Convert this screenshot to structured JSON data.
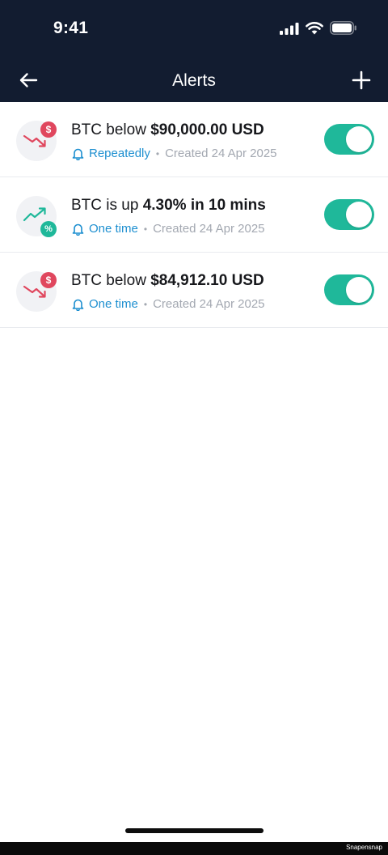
{
  "status_bar": {
    "time": "9:41"
  },
  "nav": {
    "title": "Alerts",
    "back_icon": "arrow-left-icon",
    "add_icon": "plus-icon"
  },
  "colors": {
    "header_bg": "#121c30",
    "accent_teal": "#1fb89a",
    "badge_red": "#e0475e",
    "freq_blue": "#1d8fd0"
  },
  "alerts": [
    {
      "icon": "price-down-dollar-icon",
      "badge": "$",
      "title_prefix": "BTC below ",
      "title_value": "$90,000.00 USD",
      "frequency": "Repeatedly",
      "separator": "•",
      "created": "Created 24 Apr 2025",
      "enabled": true
    },
    {
      "icon": "price-up-percent-icon",
      "badge": "%",
      "title_prefix": "BTC is up ",
      "title_value": "4.30% in 10 mins",
      "frequency": "One time",
      "separator": "•",
      "created": "Created 24 Apr 2025",
      "enabled": true
    },
    {
      "icon": "price-down-dollar-icon",
      "badge": "$",
      "title_prefix": "BTC below ",
      "title_value": "$84,912.10 USD",
      "frequency": "One time",
      "separator": "•",
      "created": "Created 24 Apr 2025",
      "enabled": true
    }
  ],
  "watermark": "Snapensnap"
}
